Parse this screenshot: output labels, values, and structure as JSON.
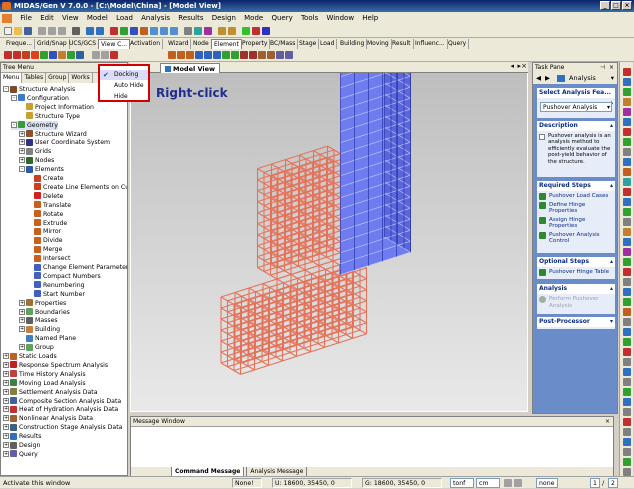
{
  "window": {
    "title": "MIDAS/Gen V 7.0.0 - [C:\\Model\\China] - [Model View]"
  },
  "menubar": [
    "File",
    "Edit",
    "View",
    "Model",
    "Load",
    "Analysis",
    "Results",
    "Design",
    "Mode",
    "Query",
    "Tools",
    "Window",
    "Help"
  ],
  "toolbar_tabs_left": [
    "Freque...",
    "Grid/Snap",
    "UCS/GCS",
    "View C...",
    "Activation"
  ],
  "toolbar_tabs_right": [
    "Wizard",
    "Node",
    "Element",
    "Property",
    "BC/Mass",
    "Stage",
    "Load",
    "Building",
    "Moving",
    "Result",
    "Influenc...",
    "Query"
  ],
  "toolbar_tabs_right_selected": "Element",
  "tree_menu": {
    "header": "Tree Menu",
    "tabs": [
      "Menu",
      "Tables",
      "Group",
      "Works"
    ],
    "selected_tab": "Menu",
    "items": [
      {
        "label": "Structure Analysis",
        "level": 0,
        "exp": "-",
        "icon": "#7a4a2a"
      },
      {
        "label": "Configuration",
        "level": 1,
        "exp": "-",
        "icon": "#3a7ac8"
      },
      {
        "label": "Project Information",
        "level": 2,
        "exp": "",
        "icon": "#c8a030"
      },
      {
        "label": "Structure Type",
        "level": 2,
        "exp": "",
        "icon": "#c8a030"
      },
      {
        "label": "Geometry",
        "level": 1,
        "exp": "-",
        "icon": "#3a9a3a",
        "selected": true
      },
      {
        "label": "Structure Wizard",
        "level": 2,
        "exp": "+",
        "icon": "#8a5030"
      },
      {
        "label": "User Coordinate System",
        "level": 2,
        "exp": "+",
        "icon": "#30308a"
      },
      {
        "label": "Grids",
        "level": 2,
        "exp": "+",
        "icon": "#808080"
      },
      {
        "label": "Nodes",
        "level": 2,
        "exp": "+",
        "icon": "#2a6a2a"
      },
      {
        "label": "Elements",
        "level": 2,
        "exp": "-",
        "icon": "#2a5aa0"
      },
      {
        "label": "Create",
        "level": 3,
        "exp": "",
        "icon": "#c84020"
      },
      {
        "label": "Create Line Elements on Curve",
        "level": 3,
        "exp": "",
        "icon": "#c84020"
      },
      {
        "label": "Delete",
        "level": 3,
        "exp": "",
        "icon": "#d02020"
      },
      {
        "label": "Translate",
        "level": 3,
        "exp": "",
        "icon": "#c86020"
      },
      {
        "label": "Rotate",
        "level": 3,
        "exp": "",
        "icon": "#c86020"
      },
      {
        "label": "Extrude",
        "level": 3,
        "exp": "",
        "icon": "#c86020"
      },
      {
        "label": "Mirror",
        "level": 3,
        "exp": "",
        "icon": "#c86020"
      },
      {
        "label": "Divide",
        "level": 3,
        "exp": "",
        "icon": "#c86020"
      },
      {
        "label": "Merge",
        "level": 3,
        "exp": "",
        "icon": "#c86020"
      },
      {
        "label": "Intersect",
        "level": 3,
        "exp": "",
        "icon": "#c86020"
      },
      {
        "label": "Change Element Parameters",
        "level": 3,
        "exp": "",
        "icon": "#4060c0"
      },
      {
        "label": "Compact Numbers",
        "level": 3,
        "exp": "",
        "icon": "#4060c0"
      },
      {
        "label": "Renumbering",
        "level": 3,
        "exp": "",
        "icon": "#4060c0"
      },
      {
        "label": "Start Number",
        "level": 3,
        "exp": "",
        "icon": "#4060c0"
      },
      {
        "label": "Properties",
        "level": 2,
        "exp": "+",
        "icon": "#a07030"
      },
      {
        "label": "Boundaries",
        "level": 2,
        "exp": "+",
        "icon": "#60a060"
      },
      {
        "label": "Masses",
        "level": 2,
        "exp": "+",
        "icon": "#606060"
      },
      {
        "label": "Building",
        "level": 2,
        "exp": "+",
        "icon": "#c08040"
      },
      {
        "label": "Named Plane",
        "level": 2,
        "exp": "",
        "icon": "#4080c0"
      },
      {
        "label": "Group",
        "level": 2,
        "exp": "+",
        "icon": "#60a060"
      },
      {
        "label": "Static Loads",
        "level": 0,
        "exp": "+",
        "icon": "#c06020"
      },
      {
        "label": "Response Spectrum Analysis",
        "level": 0,
        "exp": "+",
        "icon": "#c02020"
      },
      {
        "label": "Time History Analysis",
        "level": 0,
        "exp": "+",
        "icon": "#c04040"
      },
      {
        "label": "Moving Load Analysis",
        "level": 0,
        "exp": "+",
        "icon": "#408040"
      },
      {
        "label": "Settlement Analysis Data",
        "level": 0,
        "exp": "+",
        "icon": "#808040"
      },
      {
        "label": "Composite Section Analysis Data",
        "level": 0,
        "exp": "+",
        "icon": "#4060a0"
      },
      {
        "label": "Heat of Hydration Analysis Data",
        "level": 0,
        "exp": "+",
        "icon": "#c03030"
      },
      {
        "label": "Nonlinear Analysis Data",
        "level": 0,
        "exp": "+",
        "icon": "#a06030"
      },
      {
        "label": "Construction Stage Analysis Data",
        "level": 0,
        "exp": "+",
        "icon": "#406080"
      },
      {
        "label": "Results",
        "level": 0,
        "exp": "+",
        "icon": "#3070c0"
      },
      {
        "label": "Design",
        "level": 0,
        "exp": "+",
        "icon": "#606060"
      },
      {
        "label": "Query",
        "level": 0,
        "exp": "+",
        "icon": "#6060a0"
      }
    ]
  },
  "view": {
    "tab_label": "Model View"
  },
  "context_menu": {
    "items": [
      {
        "label": "Docking",
        "checked": true
      },
      {
        "label": "Auto Hide",
        "checked": false
      },
      {
        "label": "Hide",
        "checked": false
      }
    ]
  },
  "annotation": "Right-click",
  "message_window": {
    "header": "Message Window",
    "tabs": [
      "Command Message",
      "Analysis Message"
    ],
    "selected_tab": "Command Message"
  },
  "task_pane": {
    "header": "Task Pane",
    "dropdown_value": "Analysis",
    "select_heading": "Select Analysis Fea...",
    "select_value": "Pushover Analysis",
    "description_heading": "Description",
    "description_text": "Pushover analysis is an analysis method to efficiently evaluate the post-yield behavior of the structure.",
    "required_heading": "Required Steps",
    "required_steps": [
      "Pushover Load Cases",
      "Define Hinge Properties",
      "Assign Hinge Properties",
      "Pushover Analysis Control"
    ],
    "optional_heading": "Optional Steps",
    "optional_steps": [
      "Pushover Hinge Table"
    ],
    "analysis_heading": "Analysis",
    "analysis_steps": [
      "Perform Pushover Analysis"
    ],
    "postproc_heading": "Post-Processor"
  },
  "status": {
    "message": "Activate this window",
    "none": "None!",
    "coord_u": "U: 18600, 35450, 0",
    "coord_g": "G: 18600, 35450, 0",
    "force_unit": "tonf",
    "length_unit": "cm",
    "filter": "none",
    "page_current": "1",
    "page_total": "2"
  },
  "colors": {
    "frame": "#e4735a",
    "tower": "#5d6be6",
    "title_bar": "#0a246a",
    "annotation": "#1f2f8f",
    "highlight": "#d00000"
  }
}
